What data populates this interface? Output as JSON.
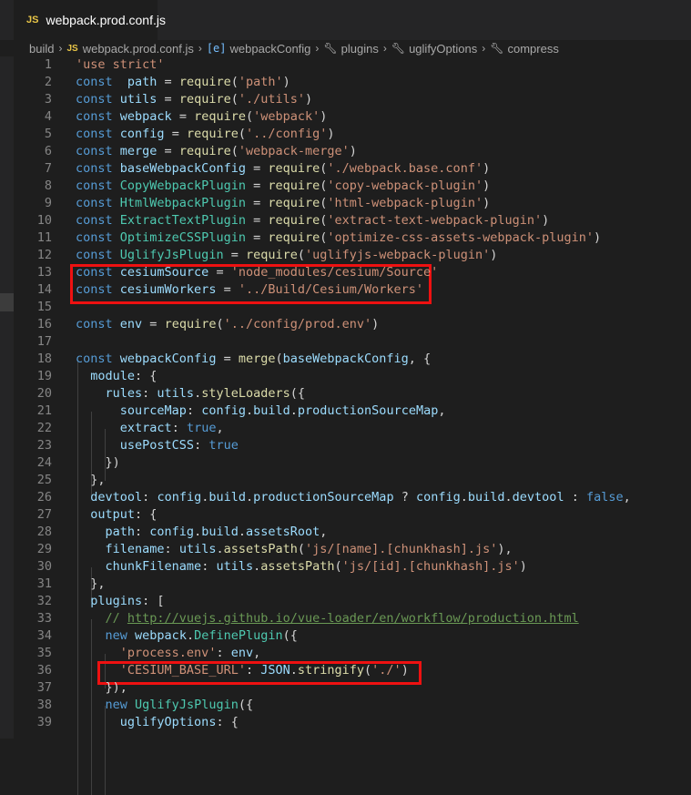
{
  "tab": {
    "icon_label": "JS",
    "title": "webpack.prod.conf.js"
  },
  "breadcrumb": {
    "folder": "build",
    "file": "webpack.prod.conf.js",
    "items": [
      "webpackConfig",
      "plugins",
      "uglifyOptions",
      "compress"
    ]
  },
  "icons": {
    "file": "js-file-icon",
    "variable": "variable-icon",
    "property": "wrench-icon"
  },
  "colors": {
    "keyword": "#569cd6",
    "variable": "#9cdcfe",
    "string": "#ce9178",
    "function": "#dcdcaa",
    "class": "#4ec9b0",
    "comment": "#6a9955",
    "highlight": "#ee1111"
  },
  "lines": [
    {
      "n": "1",
      "t": [
        [
          "str",
          "'use strict'"
        ]
      ]
    },
    {
      "n": "2",
      "t": [
        [
          "kw",
          "const"
        ],
        [
          "",
          "  "
        ],
        [
          "var",
          "path"
        ],
        [
          "",
          " = "
        ],
        [
          "fn",
          "require"
        ],
        [
          "",
          "("
        ],
        [
          "str",
          "'path'"
        ],
        [
          "",
          ")"
        ]
      ]
    },
    {
      "n": "3",
      "t": [
        [
          "kw",
          "const"
        ],
        [
          "",
          " "
        ],
        [
          "var",
          "utils"
        ],
        [
          "",
          " = "
        ],
        [
          "fn",
          "require"
        ],
        [
          "",
          "("
        ],
        [
          "str",
          "'./utils'"
        ],
        [
          "",
          ")"
        ]
      ]
    },
    {
      "n": "4",
      "t": [
        [
          "kw",
          "const"
        ],
        [
          "",
          " "
        ],
        [
          "var",
          "webpack"
        ],
        [
          "",
          " = "
        ],
        [
          "fn",
          "require"
        ],
        [
          "",
          "("
        ],
        [
          "str",
          "'webpack'"
        ],
        [
          "",
          ")"
        ]
      ]
    },
    {
      "n": "5",
      "t": [
        [
          "kw",
          "const"
        ],
        [
          "",
          " "
        ],
        [
          "var",
          "config"
        ],
        [
          "",
          " = "
        ],
        [
          "fn",
          "require"
        ],
        [
          "",
          "("
        ],
        [
          "str",
          "'../config'"
        ],
        [
          "",
          ")"
        ]
      ]
    },
    {
      "n": "6",
      "t": [
        [
          "kw",
          "const"
        ],
        [
          "",
          " "
        ],
        [
          "var",
          "merge"
        ],
        [
          "",
          " = "
        ],
        [
          "fn",
          "require"
        ],
        [
          "",
          "("
        ],
        [
          "str",
          "'webpack-merge'"
        ],
        [
          "",
          ")"
        ]
      ]
    },
    {
      "n": "7",
      "t": [
        [
          "kw",
          "const"
        ],
        [
          "",
          " "
        ],
        [
          "var",
          "baseWebpackConfig"
        ],
        [
          "",
          " = "
        ],
        [
          "fn",
          "require"
        ],
        [
          "",
          "("
        ],
        [
          "str",
          "'./webpack.base.conf'"
        ],
        [
          "",
          ")"
        ]
      ]
    },
    {
      "n": "8",
      "t": [
        [
          "kw",
          "const"
        ],
        [
          "",
          " "
        ],
        [
          "cls",
          "CopyWebpackPlugin"
        ],
        [
          "",
          " = "
        ],
        [
          "fn",
          "require"
        ],
        [
          "",
          "("
        ],
        [
          "str",
          "'copy-webpack-plugin'"
        ],
        [
          "",
          ")"
        ]
      ]
    },
    {
      "n": "9",
      "t": [
        [
          "kw",
          "const"
        ],
        [
          "",
          " "
        ],
        [
          "cls",
          "HtmlWebpackPlugin"
        ],
        [
          "",
          " = "
        ],
        [
          "fn",
          "require"
        ],
        [
          "",
          "("
        ],
        [
          "str",
          "'html-webpack-plugin'"
        ],
        [
          "",
          ")"
        ]
      ]
    },
    {
      "n": "10",
      "t": [
        [
          "kw",
          "const"
        ],
        [
          "",
          " "
        ],
        [
          "cls",
          "ExtractTextPlugin"
        ],
        [
          "",
          " = "
        ],
        [
          "fn",
          "require"
        ],
        [
          "",
          "("
        ],
        [
          "str",
          "'extract-text-webpack-plugin'"
        ],
        [
          "",
          ")"
        ]
      ]
    },
    {
      "n": "11",
      "t": [
        [
          "kw",
          "const"
        ],
        [
          "",
          " "
        ],
        [
          "cls",
          "OptimizeCSSPlugin"
        ],
        [
          "",
          " = "
        ],
        [
          "fn",
          "require"
        ],
        [
          "",
          "("
        ],
        [
          "str",
          "'optimize-css-assets-webpack-plugin'"
        ],
        [
          "",
          ")"
        ]
      ]
    },
    {
      "n": "12",
      "t": [
        [
          "kw",
          "const"
        ],
        [
          "",
          " "
        ],
        [
          "cls",
          "UglifyJsPlugin"
        ],
        [
          "",
          " = "
        ],
        [
          "fn",
          "require"
        ],
        [
          "",
          "("
        ],
        [
          "str",
          "'uglifyjs-webpack-plugin'"
        ],
        [
          "",
          ")"
        ]
      ]
    },
    {
      "n": "13",
      "t": [
        [
          "kw",
          "const"
        ],
        [
          "",
          " "
        ],
        [
          "var",
          "cesiumSource"
        ],
        [
          "",
          " = "
        ],
        [
          "str",
          "'node_modules/cesium/Source'"
        ]
      ]
    },
    {
      "n": "14",
      "t": [
        [
          "kw",
          "const"
        ],
        [
          "",
          " "
        ],
        [
          "var",
          "cesiumWorkers"
        ],
        [
          "",
          " = "
        ],
        [
          "str",
          "'../Build/Cesium/Workers'"
        ]
      ]
    },
    {
      "n": "15",
      "t": []
    },
    {
      "n": "16",
      "t": [
        [
          "kw",
          "const"
        ],
        [
          "",
          " "
        ],
        [
          "var",
          "env"
        ],
        [
          "",
          " = "
        ],
        [
          "fn",
          "require"
        ],
        [
          "",
          "("
        ],
        [
          "str",
          "'../config/prod.env'"
        ],
        [
          "",
          ")"
        ]
      ]
    },
    {
      "n": "17",
      "t": []
    },
    {
      "n": "18",
      "t": [
        [
          "kw",
          "const"
        ],
        [
          "",
          " "
        ],
        [
          "var",
          "webpackConfig"
        ],
        [
          "",
          " = "
        ],
        [
          "fn",
          "merge"
        ],
        [
          "",
          "("
        ],
        [
          "var",
          "baseWebpackConfig"
        ],
        [
          "",
          ", {"
        ]
      ]
    },
    {
      "n": "19",
      "t": [
        [
          "",
          "  "
        ],
        [
          "var",
          "module"
        ],
        [
          "",
          ": {"
        ]
      ]
    },
    {
      "n": "20",
      "t": [
        [
          "",
          "    "
        ],
        [
          "var",
          "rules"
        ],
        [
          "",
          ": "
        ],
        [
          "var",
          "utils"
        ],
        [
          "",
          "."
        ],
        [
          "fn",
          "styleLoaders"
        ],
        [
          "",
          "({"
        ]
      ]
    },
    {
      "n": "21",
      "t": [
        [
          "",
          "      "
        ],
        [
          "var",
          "sourceMap"
        ],
        [
          "",
          ": "
        ],
        [
          "var",
          "config"
        ],
        [
          "",
          "."
        ],
        [
          "var",
          "build"
        ],
        [
          "",
          "."
        ],
        [
          "var",
          "productionSourceMap"
        ],
        [
          "",
          ","
        ]
      ]
    },
    {
      "n": "22",
      "t": [
        [
          "",
          "      "
        ],
        [
          "var",
          "extract"
        ],
        [
          "",
          ": "
        ],
        [
          "kw",
          "true"
        ],
        [
          "",
          ","
        ]
      ]
    },
    {
      "n": "23",
      "t": [
        [
          "",
          "      "
        ],
        [
          "var",
          "usePostCSS"
        ],
        [
          "",
          ": "
        ],
        [
          "kw",
          "true"
        ]
      ]
    },
    {
      "n": "24",
      "t": [
        [
          "",
          "    })"
        ]
      ]
    },
    {
      "n": "25",
      "t": [
        [
          "",
          "  },"
        ]
      ]
    },
    {
      "n": "26",
      "t": [
        [
          "",
          "  "
        ],
        [
          "var",
          "devtool"
        ],
        [
          "",
          ": "
        ],
        [
          "var",
          "config"
        ],
        [
          "",
          "."
        ],
        [
          "var",
          "build"
        ],
        [
          "",
          "."
        ],
        [
          "var",
          "productionSourceMap"
        ],
        [
          "",
          " ? "
        ],
        [
          "var",
          "config"
        ],
        [
          "",
          "."
        ],
        [
          "var",
          "build"
        ],
        [
          "",
          "."
        ],
        [
          "var",
          "devtool"
        ],
        [
          "",
          " : "
        ],
        [
          "kw",
          "false"
        ],
        [
          "",
          ","
        ]
      ]
    },
    {
      "n": "27",
      "t": [
        [
          "",
          "  "
        ],
        [
          "var",
          "output"
        ],
        [
          "",
          ": {"
        ]
      ]
    },
    {
      "n": "28",
      "t": [
        [
          "",
          "    "
        ],
        [
          "var",
          "path"
        ],
        [
          "",
          ": "
        ],
        [
          "var",
          "config"
        ],
        [
          "",
          "."
        ],
        [
          "var",
          "build"
        ],
        [
          "",
          "."
        ],
        [
          "var",
          "assetsRoot"
        ],
        [
          "",
          ","
        ]
      ]
    },
    {
      "n": "29",
      "t": [
        [
          "",
          "    "
        ],
        [
          "var",
          "filename"
        ],
        [
          "",
          ": "
        ],
        [
          "var",
          "utils"
        ],
        [
          "",
          "."
        ],
        [
          "fn",
          "assetsPath"
        ],
        [
          "",
          "("
        ],
        [
          "str",
          "'js/[name].[chunkhash].js'"
        ],
        [
          "",
          "),"
        ]
      ]
    },
    {
      "n": "30",
      "t": [
        [
          "",
          "    "
        ],
        [
          "var",
          "chunkFilename"
        ],
        [
          "",
          ": "
        ],
        [
          "var",
          "utils"
        ],
        [
          "",
          "."
        ],
        [
          "fn",
          "assetsPath"
        ],
        [
          "",
          "("
        ],
        [
          "str",
          "'js/[id].[chunkhash].js'"
        ],
        [
          "",
          ")"
        ]
      ]
    },
    {
      "n": "31",
      "t": [
        [
          "",
          "  },"
        ]
      ]
    },
    {
      "n": "32",
      "t": [
        [
          "",
          "  "
        ],
        [
          "var",
          "plugins"
        ],
        [
          "",
          ": ["
        ]
      ]
    },
    {
      "n": "33",
      "t": [
        [
          "",
          "    "
        ],
        [
          "cmt",
          "// "
        ],
        [
          "cmt link",
          "http://vuejs.github.io/vue-loader/en/workflow/production.html"
        ]
      ]
    },
    {
      "n": "34",
      "t": [
        [
          "",
          "    "
        ],
        [
          "kw",
          "new"
        ],
        [
          "",
          " "
        ],
        [
          "var",
          "webpack"
        ],
        [
          "",
          "."
        ],
        [
          "cls",
          "DefinePlugin"
        ],
        [
          "",
          "({"
        ]
      ]
    },
    {
      "n": "35",
      "t": [
        [
          "",
          "      "
        ],
        [
          "str",
          "'process.env'"
        ],
        [
          "",
          ": "
        ],
        [
          "var",
          "env"
        ],
        [
          "",
          ","
        ]
      ]
    },
    {
      "n": "36",
      "t": [
        [
          "",
          "      "
        ],
        [
          "str",
          "'CESIUM_BASE_URL'"
        ],
        [
          "",
          ": "
        ],
        [
          "var",
          "JSON"
        ],
        [
          "",
          "."
        ],
        [
          "fn",
          "stringify"
        ],
        [
          "",
          "("
        ],
        [
          "str",
          "'./'"
        ],
        [
          "",
          ")"
        ]
      ]
    },
    {
      "n": "37",
      "t": [
        [
          "",
          "    }),"
        ]
      ]
    },
    {
      "n": "38",
      "t": [
        [
          "",
          "    "
        ],
        [
          "kw",
          "new"
        ],
        [
          "",
          " "
        ],
        [
          "cls",
          "UglifyJsPlugin"
        ],
        [
          "",
          "({"
        ]
      ]
    },
    {
      "n": "39",
      "t": [
        [
          "",
          "      "
        ],
        [
          "var",
          "uglifyOptions"
        ],
        [
          "",
          ": {"
        ]
      ]
    }
  ]
}
